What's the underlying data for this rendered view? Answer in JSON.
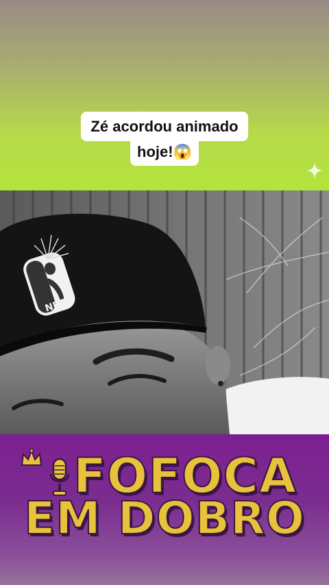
{
  "caption": {
    "line1": "Zé acordou animado",
    "line2": "hoje!😱"
  },
  "banner": {
    "line1": "FOFOCA",
    "line2": "EM DOBRO"
  },
  "photo": {
    "cap_logo_text": "NBA"
  },
  "colors": {
    "top_band": "#b3e43c",
    "bottom_band": "#7c1f91",
    "logo_gold": "#e8c23a"
  },
  "icons": [
    "sparkle-icon",
    "crown-icon",
    "microphone-icon"
  ]
}
